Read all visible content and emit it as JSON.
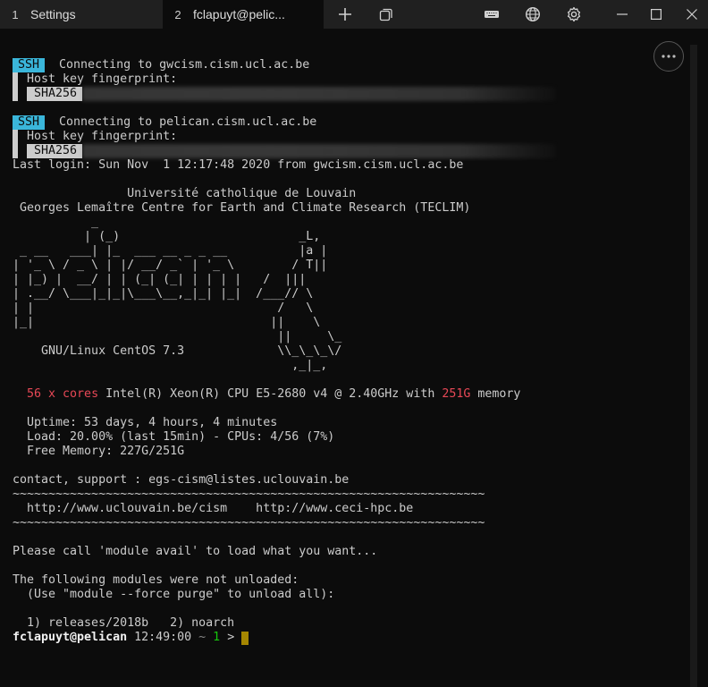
{
  "tabs": [
    {
      "number": "1",
      "title": "Settings"
    },
    {
      "number": "2",
      "title": "fclapuyt@pelic..."
    }
  ],
  "toolbar_icons": [
    "plus-icon",
    "duplicate-icon",
    "keyboard-icon",
    "globe-icon",
    "gear-icon"
  ],
  "window_icons": [
    "minimize-icon",
    "maximize-icon",
    "close-icon"
  ],
  "ssh": [
    {
      "badge": "SSH",
      "connecting": " Connecting to gwcism.cism.ucl.ac.be",
      "fingerprint_label": "Host key fingerprint:",
      "hash_badge": "SHA256"
    },
    {
      "badge": "SSH",
      "connecting": " Connecting to pelican.cism.ucl.ac.be",
      "fingerprint_label": "Host key fingerprint:",
      "hash_badge": "SHA256"
    }
  ],
  "motd": {
    "last_login": "Last login: Sun Nov  1 12:17:48 2020 from gwcism.cism.ucl.ac.be",
    "title_1": "                Université catholique de Louvain",
    "title_2": " Georges Lemaître Centre for Earth and Climate Research (TECLIM)",
    "ascii_art": [
      "           _",
      "          | (_)                         _L,",
      " _ __   ___| |_  ___ __ _ _ __          |a |",
      "| '_ \\ / _ \\ | |/ __/ _` | '_ \\        / T||",
      "| |_) |  __/ | | (_| (_| | | | |   /  |||",
      "| .__/ \\___|_|_|\\___\\__,_|_| |_|  /___// \\",
      "| |                                  /   \\",
      "|_|                                 ||    \\",
      "                                     ||     \\_",
      "    GNU/Linux CentOS 7.3             \\\\_\\_\\_\\/",
      "                                       ,_|_,"
    ],
    "cpu_cores": "56 x cores",
    "cpu_model": " Intel(R) Xeon(R) CPU E5-2680 v4 @ 2.40GHz with ",
    "memory_amount": "251G",
    "memory_word": " memory",
    "uptime": "  Uptime: 53 days, 4 hours, 4 minutes",
    "load": "  Load: 20.00% (last 15min) - CPUs: 4/56 (7%)",
    "free_memory": "  Free Memory: 227G/251G",
    "contact": "contact, support : egs-cism@listes.uclouvain.be",
    "separator": "~~~~~~~~~~~~~~~~~~~~~~~~~~~~~~~~~~~~~~~~~~~~~~~~~~~~~~~~~~~~~~~~~~",
    "links": "  http://www.uclouvain.be/cism    http://www.ceci-hpc.be",
    "module_hint": "Please call 'module avail' to load what you want...",
    "not_unloaded": "The following modules were not unloaded:",
    "force_hint": "  (Use \"module --force purge\" to unload all):",
    "modules_list": "  1) releases/2018b   2) noarch"
  },
  "prompt": {
    "user_host": "fclapuyt@pelican",
    "time": " 12:49:00 ",
    "tilde": "~",
    "count": " 1",
    "arrow": " > "
  },
  "colors": {
    "ssh_badge": "#3ab6da",
    "red": "#e74856",
    "green": "#16c60c",
    "cursor": "#c19c00"
  }
}
